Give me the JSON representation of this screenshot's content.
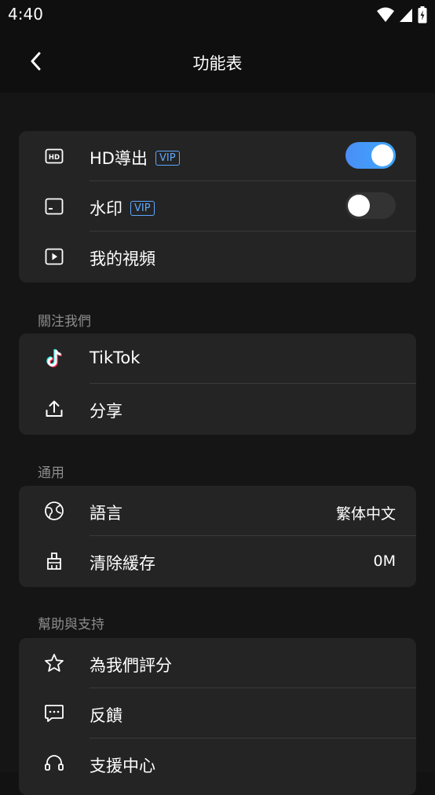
{
  "status_bar": {
    "time": "4:40"
  },
  "header": {
    "title": "功能表"
  },
  "card_features": {
    "items": [
      {
        "label": "HD導出",
        "badge": "VIP",
        "toggle": "on"
      },
      {
        "label": "水印",
        "badge": "VIP",
        "toggle": "off"
      },
      {
        "label": "我的視頻"
      }
    ]
  },
  "section_follow": {
    "title": "關注我們",
    "items": [
      {
        "label": "TikTok"
      },
      {
        "label": "分享"
      }
    ]
  },
  "section_general": {
    "title": "通用",
    "items": [
      {
        "label": "語言",
        "value": "繁体中文"
      },
      {
        "label": "清除緩存",
        "value": "0M"
      }
    ]
  },
  "section_help": {
    "title": "幫助與支持",
    "items": [
      {
        "label": "為我們評分"
      },
      {
        "label": "反饋"
      },
      {
        "label": "支援中心"
      }
    ]
  },
  "colors": {
    "accent": "#4a8ef5",
    "vip": "#5ea8ff",
    "card_bg": "#242424",
    "page_bg": "#151515"
  }
}
